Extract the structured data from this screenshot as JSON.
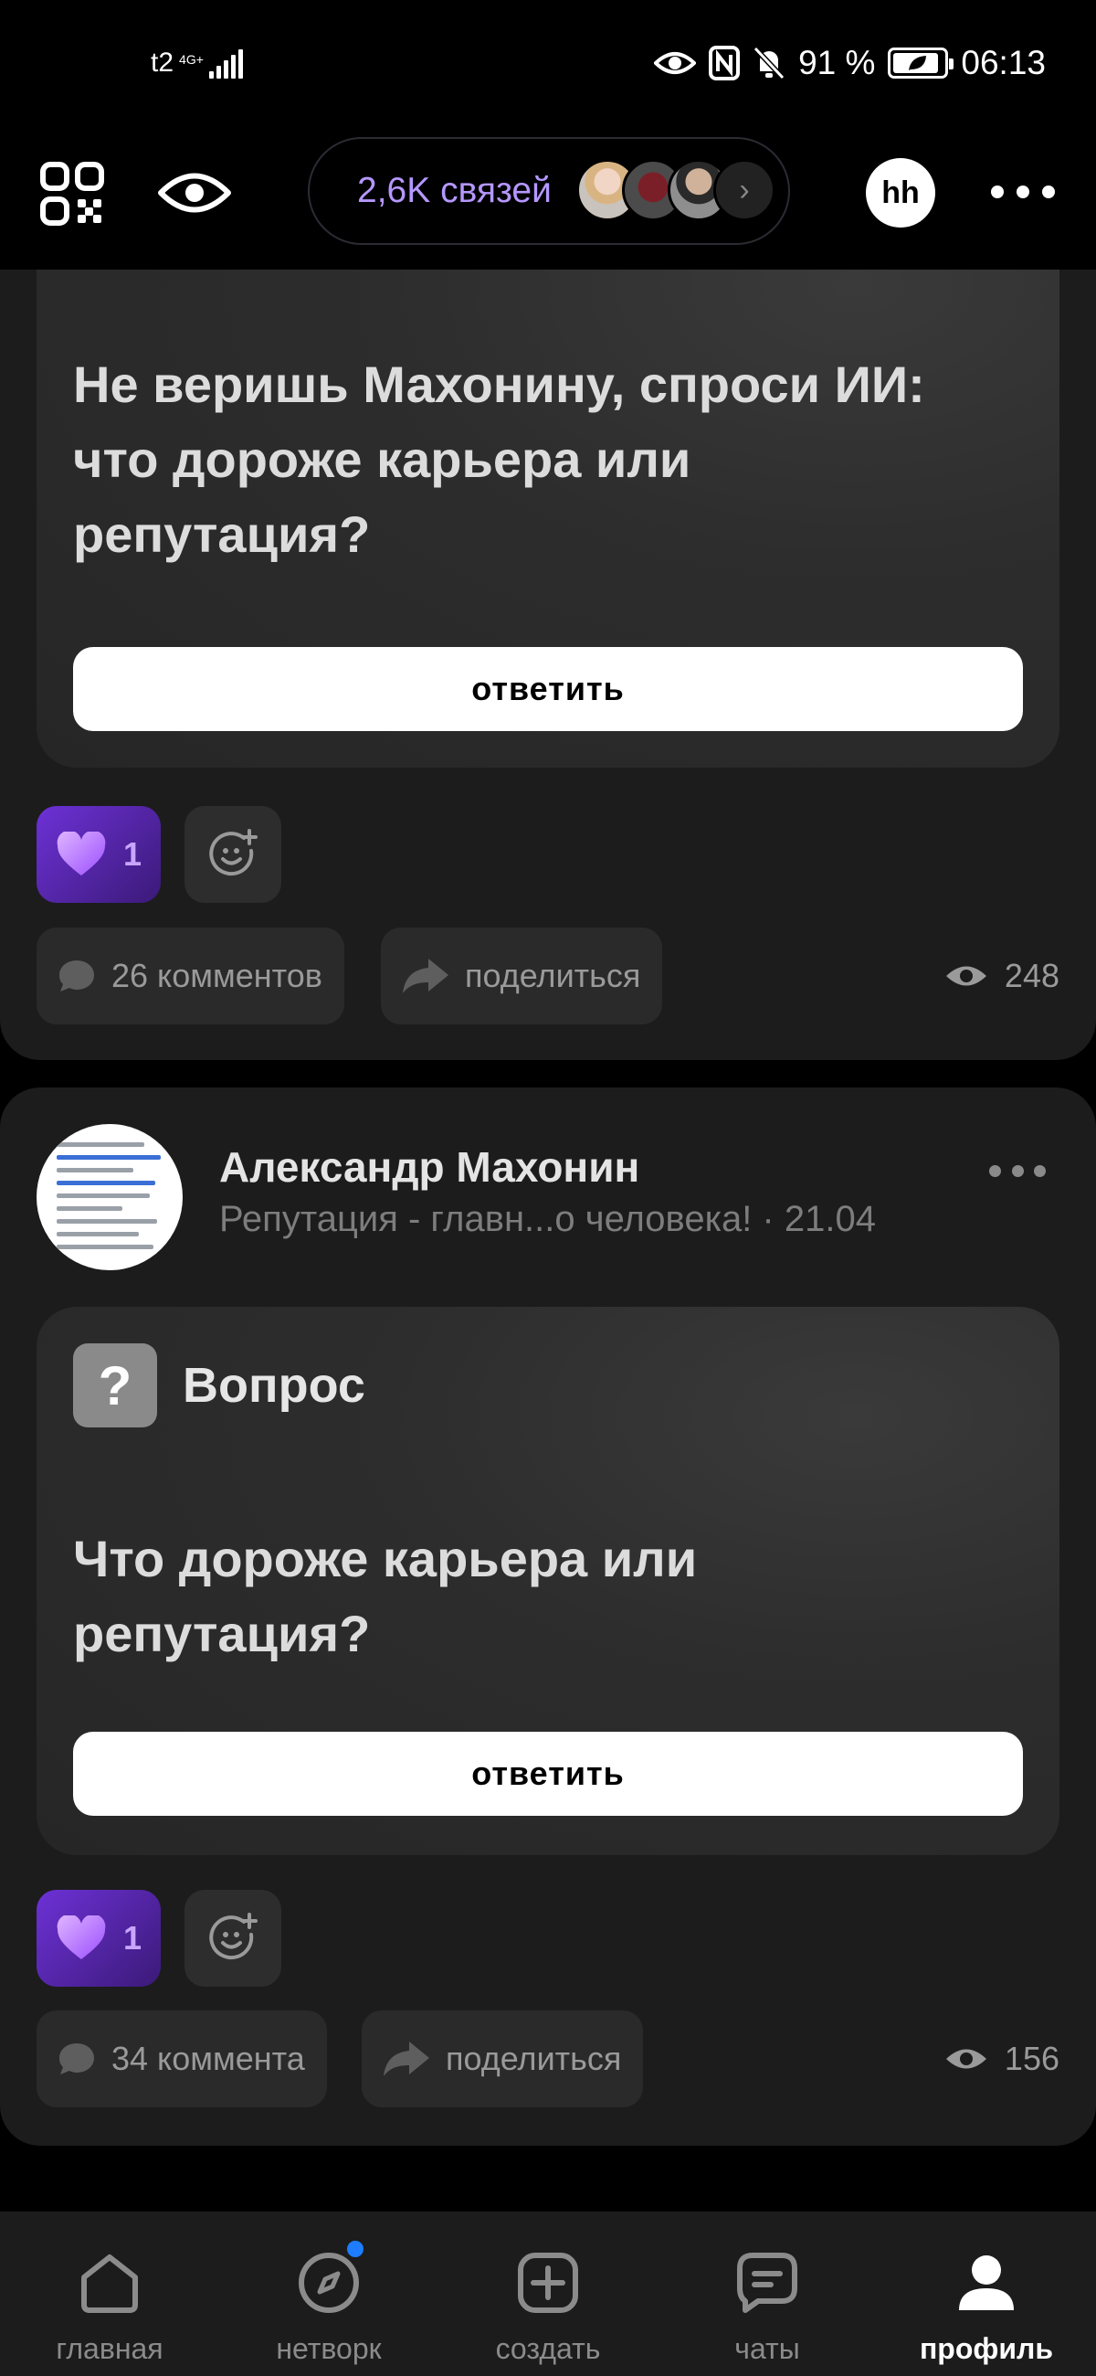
{
  "status_bar": {
    "carrier": "t2",
    "network": "4G+",
    "battery_percent": "91 %",
    "battery_level": 0.91,
    "time": "06:13"
  },
  "header": {
    "connections_label": "2,6K связей",
    "avatar_initials": "hh"
  },
  "posts": [
    {
      "question": "Не веришь Махонину, спроси ИИ: что дороже карьера или репутация?",
      "answer_label": "ответить",
      "likes": "1",
      "comments_label": "26 комментов",
      "share_label": "поделиться",
      "views": "248"
    },
    {
      "author_name": "Александр Махонин",
      "subtitle": "Репутация - главн...о человека! · 21.04",
      "question_badge": "?",
      "question_label": "Вопрос",
      "question": "Что дороже карьера или репутация?",
      "answer_label": "ответить",
      "likes": "1",
      "comments_label": "34 коммента",
      "share_label": "поделиться",
      "views": "156"
    }
  ],
  "bottom_nav": {
    "items": [
      {
        "label": "главная",
        "icon": "home-icon"
      },
      {
        "label": "нетворк",
        "icon": "compass-icon"
      },
      {
        "label": "создать",
        "icon": "plus-square-icon"
      },
      {
        "label": "чаты",
        "icon": "chat-icon"
      },
      {
        "label": "профиль",
        "icon": "profile-icon"
      }
    ],
    "active": "профиль"
  },
  "colors": {
    "accent_purple": "#b597ff",
    "like_gradient_start": "#6d31d6",
    "notification_dot": "#1e7cff",
    "card_bg": "#1c1c1c"
  }
}
